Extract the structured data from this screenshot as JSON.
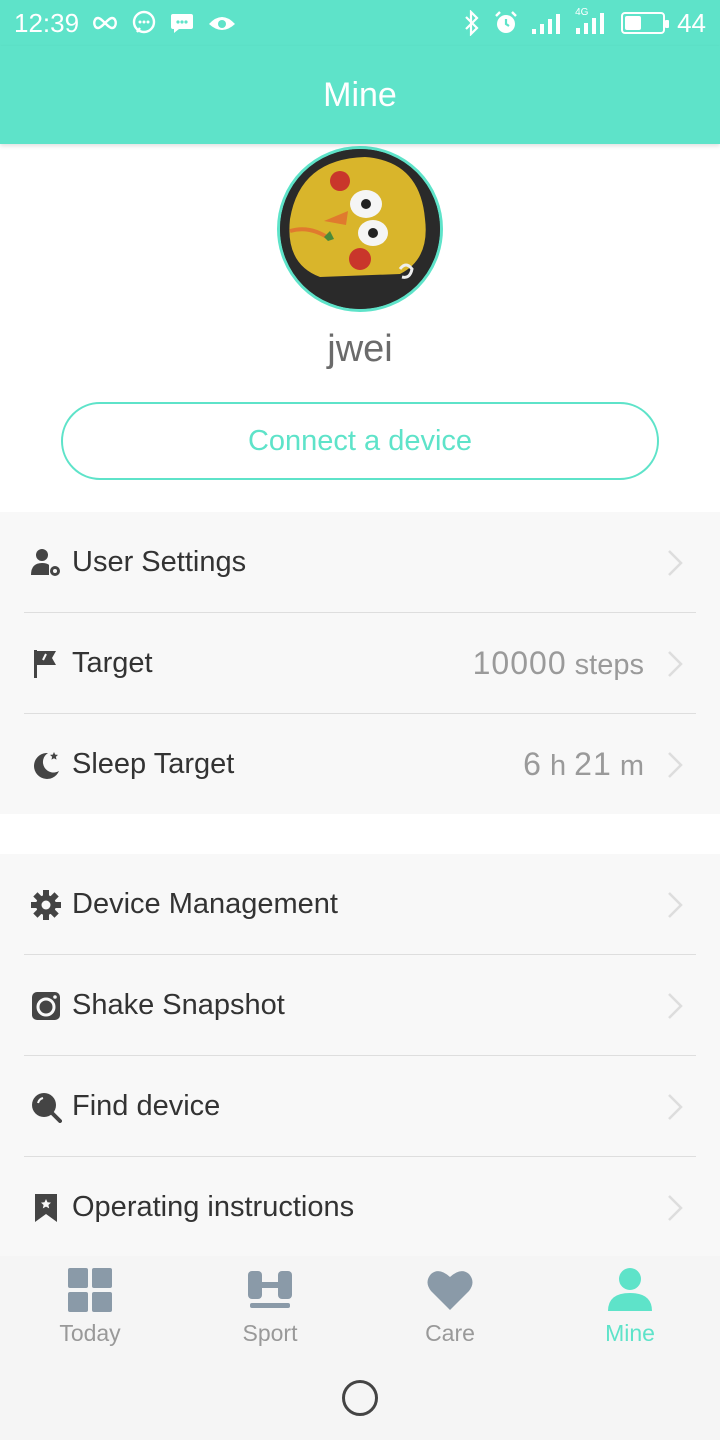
{
  "status_bar": {
    "time": "12:39",
    "battery_level": "44",
    "battery_fraction": 0.44,
    "network_label": "4G",
    "left_icons": [
      "infinity-icon",
      "chat-bubble-icon",
      "message-icon",
      "eye-icon"
    ],
    "right_icons": [
      "bluetooth-icon",
      "alarm-icon",
      "signal-icon",
      "signal-4g-icon",
      "battery-icon"
    ]
  },
  "header": {
    "title": "Mine"
  },
  "profile": {
    "username": "jwei",
    "connect_label": "Connect a device"
  },
  "settings": [
    {
      "label": "User Settings",
      "icon": "user-settings-icon"
    },
    {
      "label": "Target",
      "icon": "flag-icon",
      "value_number": "10000",
      "value_unit": "steps"
    },
    {
      "label": "Sleep Target",
      "icon": "moon-icon",
      "value_hours": "6",
      "value_hours_unit": "h",
      "value_minutes": "21",
      "value_minutes_unit": "m"
    }
  ],
  "device": [
    {
      "label": "Device Management",
      "icon": "gear-icon"
    },
    {
      "label": "Shake Snapshot",
      "icon": "camera-icon"
    },
    {
      "label": "Find device",
      "icon": "search-icon"
    },
    {
      "label": "Operating instructions",
      "icon": "bookmark-icon"
    }
  ],
  "tabs": [
    {
      "label": "Today",
      "icon": "grid-icon"
    },
    {
      "label": "Sport",
      "icon": "dumbbell-icon"
    },
    {
      "label": "Care",
      "icon": "heart-icon"
    },
    {
      "label": "Mine",
      "icon": "person-icon",
      "active": true
    }
  ],
  "colors": {
    "accent": "#5ee3c9",
    "icon_gray": "#8a9aa8",
    "text_dark": "#333333",
    "text_muted": "#9a9a9a"
  }
}
